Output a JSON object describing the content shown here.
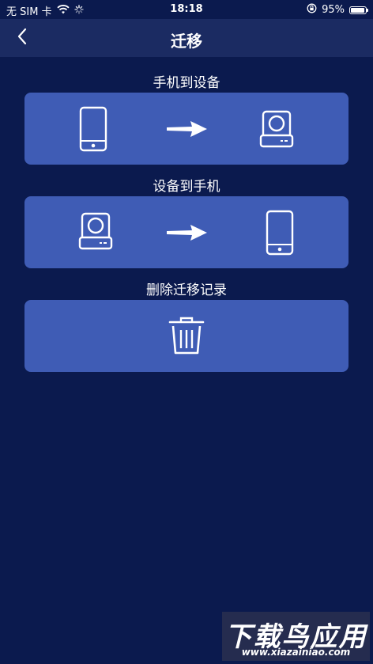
{
  "status_bar": {
    "carrier": "无 SIM 卡",
    "time": "18:18",
    "battery": "95%",
    "battery_level": 0.95
  },
  "nav": {
    "title": "迁移"
  },
  "sections": {
    "phone_to_device": {
      "label": "手机到设备"
    },
    "device_to_phone": {
      "label": "设备到手机"
    },
    "delete_records": {
      "label": "删除迁移记录"
    }
  },
  "watermark": {
    "title": "下载鸟应用",
    "url": "www.xiazainiao.com"
  },
  "colors": {
    "background": "#0b1a4e",
    "nav_bar": "#1b2b62",
    "card": "#3f5cb5",
    "icon": "#ffffff"
  },
  "icons": [
    "chevron-left-icon",
    "wifi-icon",
    "loading-icon",
    "orientation-lock-icon",
    "battery-icon",
    "phone-icon",
    "arrow-right-icon",
    "storage-device-icon",
    "trash-icon"
  ]
}
